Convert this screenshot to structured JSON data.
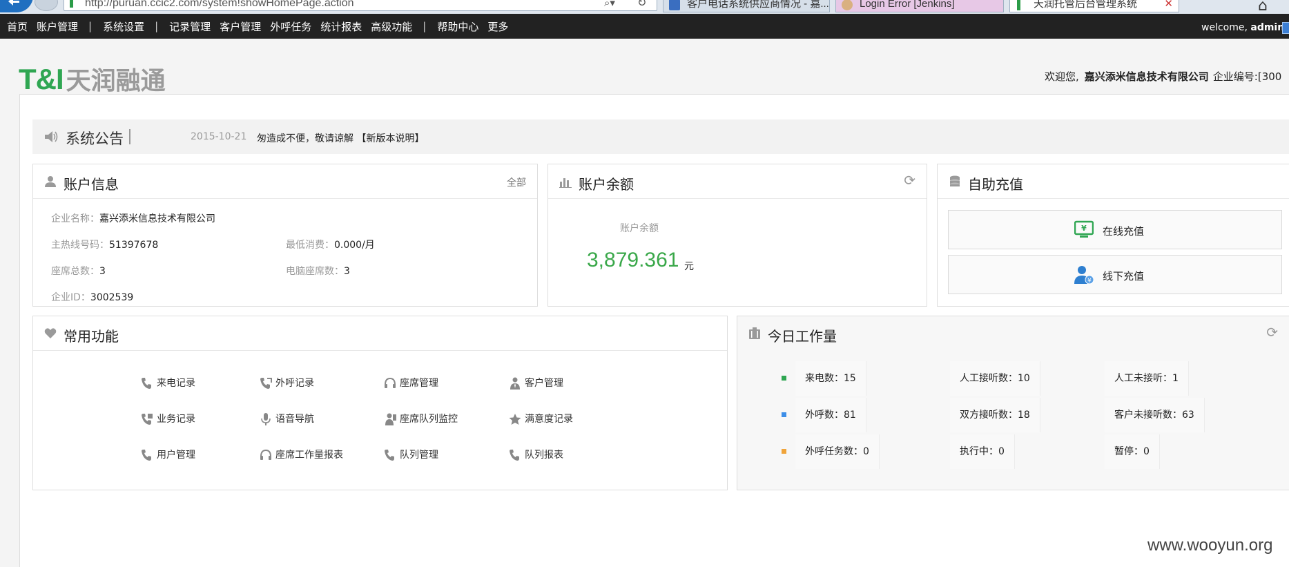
{
  "browser": {
    "url": "http://puruan.ccic2.com/system!showHomePage.action",
    "tabs": [
      {
        "title": "客户电话系统供应商情况 - 嘉..."
      },
      {
        "title": "Login Error [Jenkins]"
      },
      {
        "title": "天润托管后台管理系统"
      }
    ]
  },
  "topnav": {
    "items": [
      "首页",
      "账户管理",
      "|",
      "系统设置",
      "|",
      "记录管理",
      "客户管理",
      "外呼任务",
      "统计报表",
      "高级功能",
      "|",
      "帮助中心",
      "更多"
    ],
    "welcome_prefix": "welcome,",
    "welcome_user": "admin"
  },
  "header": {
    "logo_mark": "T&I",
    "logo_text": "天润融通",
    "greeting": "欢迎您,",
    "company": "嘉兴添米信息技术有限公司",
    "company_id_label": "企业编号:[300"
  },
  "notice": {
    "title": "系统公告",
    "date": "2015-10-21",
    "message": "匆造成不便，敬请谅解 【新版本说明】"
  },
  "account": {
    "title": "账户信息",
    "all_link": "全部",
    "fields": {
      "company_label": "企业名称：",
      "company_value": "嘉兴添米信息技术有限公司",
      "hotline_label": "主热线号码：",
      "hotline_value": "51397678",
      "min_label": "最低消费：",
      "min_value": "0.000/月",
      "seats_label": "座席总数：",
      "seats_value": "3",
      "pc_seats_label": "电脑座席数：",
      "pc_seats_value": "3",
      "id_label": "企业ID：",
      "id_value": "3002539"
    }
  },
  "balance": {
    "title": "账户余额",
    "label": "账户余额",
    "value": "3,879.361",
    "unit": "元"
  },
  "recharge": {
    "title": "自助充值",
    "online": "在线充值",
    "offline": "线下充值"
  },
  "common": {
    "title": "常用功能",
    "items": [
      "来电记录",
      "外呼记录",
      "座席管理",
      "客户管理",
      "业务记录",
      "语音导航",
      "座席队列监控",
      "满意度记录",
      "用户管理",
      "座席工作量报表",
      "队列管理",
      "队列报表"
    ]
  },
  "today": {
    "title": "今日工作量",
    "stats": [
      "来电数：15",
      "人工接听数：10",
      "人工未接听：1",
      "外呼数：81",
      "双方接听数：18",
      "客户未接听数：63",
      "外呼任务数：0",
      "执行中：0",
      "暂停：0"
    ],
    "dot_colors": [
      "#2fa652",
      "#3c8ee8",
      "#f0a43a"
    ]
  },
  "watermark": "www.wooyun.org",
  "colors": {
    "brand_green": "#2fa652",
    "balance_green": "#3aa84a",
    "nav_bg": "#222222"
  }
}
